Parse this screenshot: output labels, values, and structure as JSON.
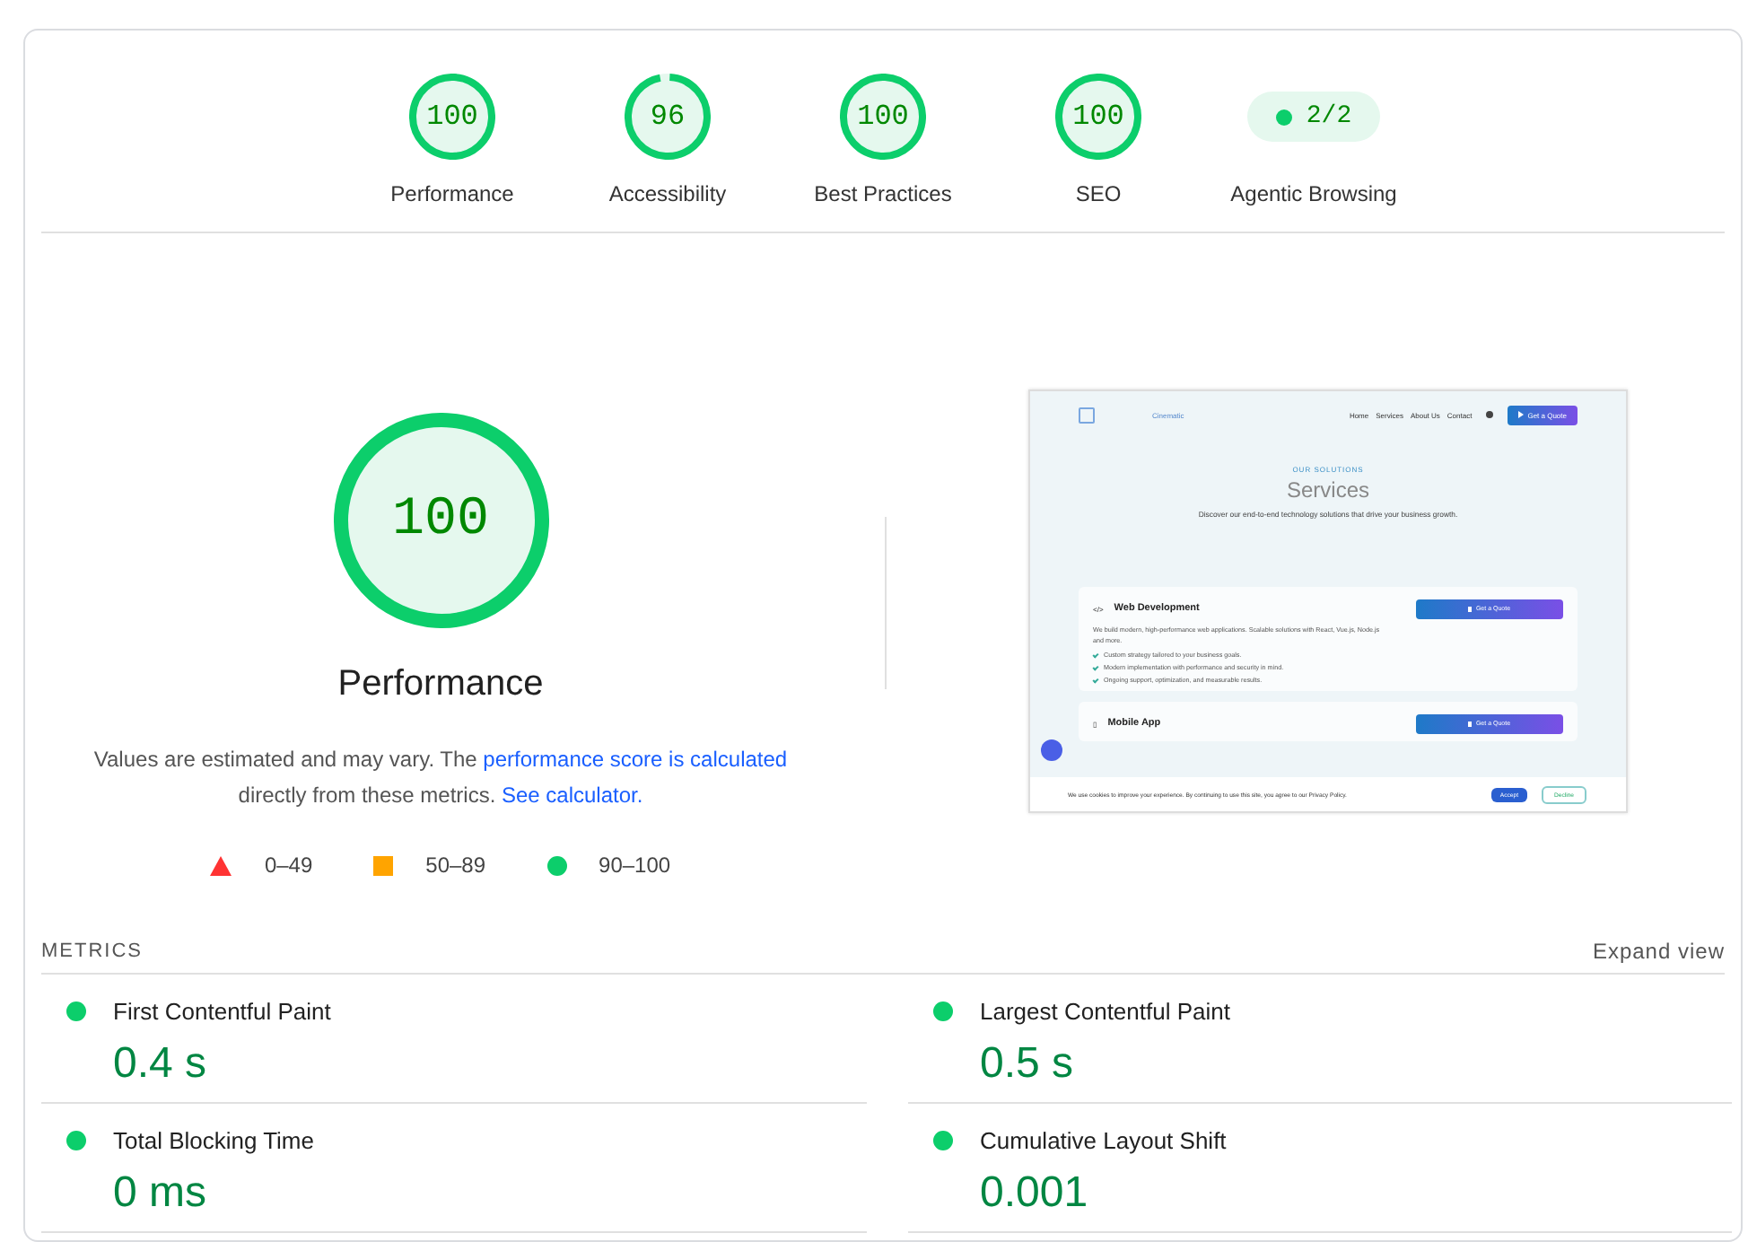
{
  "categories": [
    {
      "kind": "gauge",
      "score": "100",
      "level": 1,
      "label": "Performance"
    },
    {
      "kind": "gauge",
      "score": "96",
      "level": 0.96,
      "label": "Accessibility"
    },
    {
      "kind": "gauge",
      "score": "100",
      "level": 1,
      "label": "Best Practices"
    },
    {
      "kind": "gauge",
      "score": "100",
      "level": 1,
      "label": "SEO"
    },
    {
      "kind": "pill",
      "score": "2/2",
      "label": "Agentic Browsing",
      "color": "#0cce6b"
    }
  ],
  "performance": {
    "score": "100",
    "level": 1,
    "title": "Performance",
    "description": {
      "lead": "Values are estimated and may vary. The ",
      "score_link": "performance score is calculated",
      "middle": " directly from these metrics. ",
      "calculator_link": "See calculator."
    },
    "legend": [
      {
        "kind": "triangle",
        "range": "0–49",
        "color": "#ff3333"
      },
      {
        "kind": "square",
        "range": "50–89",
        "color": "#ffa400"
      },
      {
        "kind": "circle",
        "range": "90–100",
        "color": "#0cce6b"
      }
    ]
  },
  "screenshot": {
    "brand": "Cinematic",
    "nav": [
      "Home",
      "Services",
      "About Us",
      "Contact"
    ],
    "cta": "Get a Quote",
    "eyebrow": "OUR SOLUTIONS",
    "title": "Services",
    "subtitle": "Discover our end-to-end technology solutions that drive your business growth.",
    "cards": [
      {
        "icon": "</>",
        "title": "Web Development",
        "button": "Get a Quote",
        "text": "We build modern, high-performance web applications. Scalable solutions with React, Vue.js, Node.js and more.",
        "points": [
          "Custom strategy tailored to your business goals.",
          "Modern implementation with performance and security in mind.",
          "Ongoing support, optimization, and measurable results."
        ]
      },
      {
        "icon": "▯",
        "title": "Mobile App",
        "button": "Get a Quote"
      }
    ],
    "cookie": {
      "text": "We use cookies to improve your experience. By continuing to use this site, you agree to our Privacy Policy.",
      "accept": "Accept",
      "decline": "Decline"
    }
  },
  "metrics": {
    "heading": "METRICS",
    "expand": "Expand view",
    "items": [
      {
        "name": "First Contentful Paint",
        "value": "0.4 s",
        "color": "#0cce6b"
      },
      {
        "name": "Largest Contentful Paint",
        "value": "0.5 s",
        "color": "#0cce6b"
      },
      {
        "name": "Total Blocking Time",
        "value": "0 ms",
        "color": "#0cce6b"
      },
      {
        "name": "Cumulative Layout Shift",
        "value": "0.001",
        "color": "#0cce6b"
      }
    ]
  }
}
